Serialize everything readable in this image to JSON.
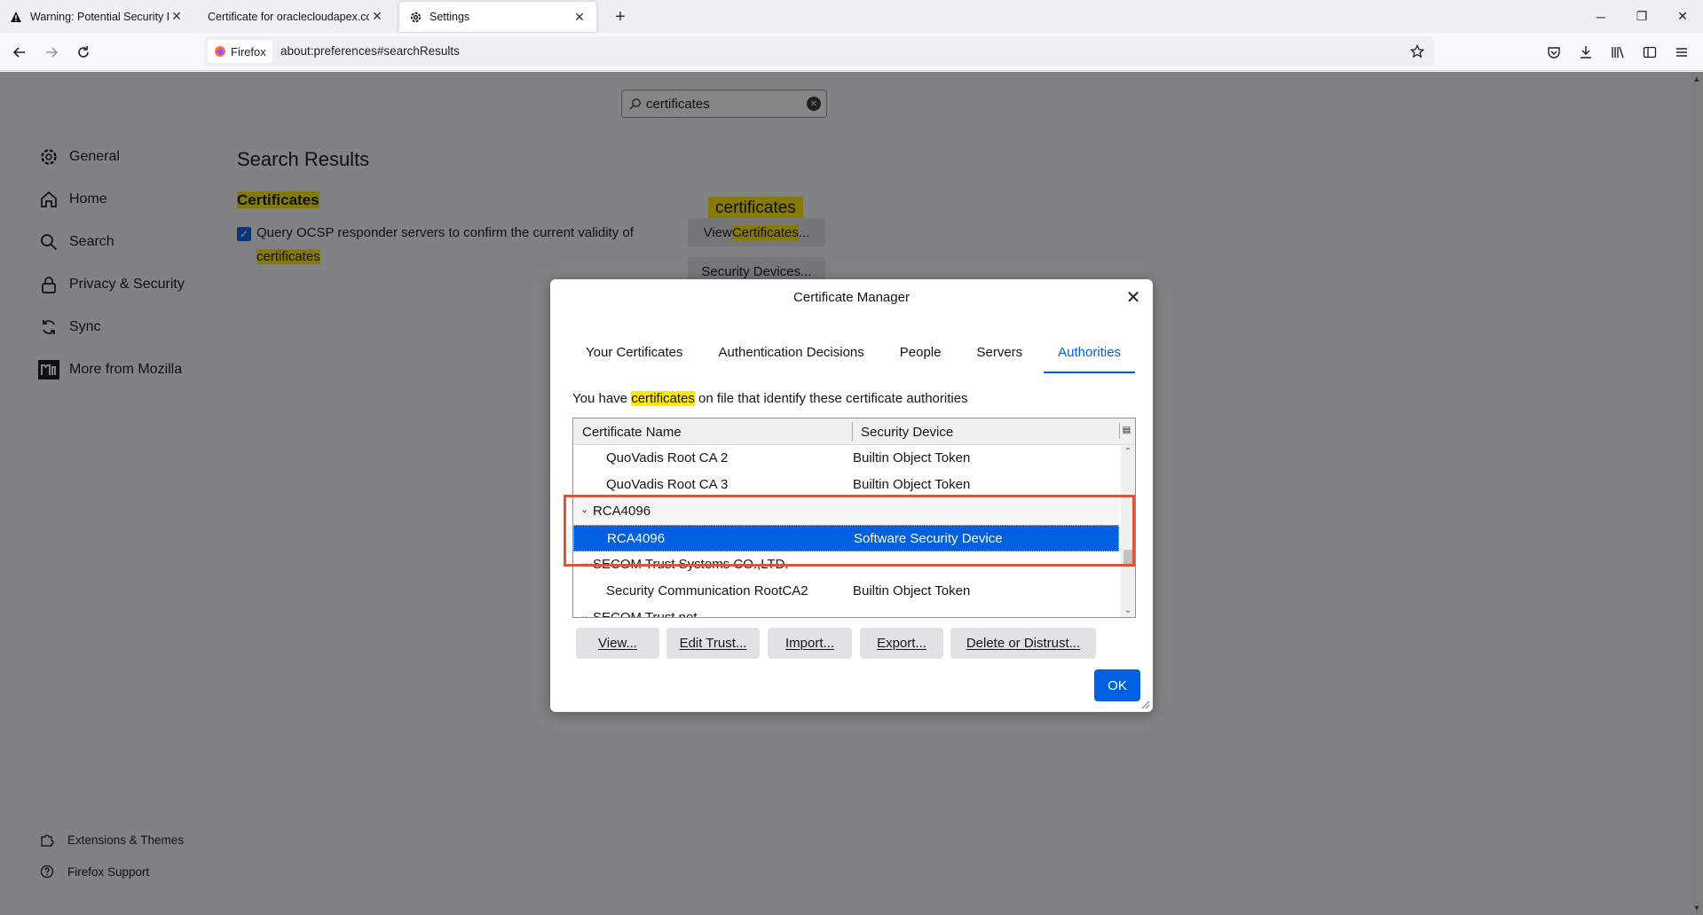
{
  "tabs": [
    {
      "title": "Warning: Potential Security Risk",
      "icon": "warning-icon"
    },
    {
      "title": "Certificate for oraclecloudapex.com",
      "icon": "none"
    },
    {
      "title": "Settings",
      "icon": "gear-icon",
      "active": true
    }
  ],
  "urlbar": {
    "identity_label": "Firefox",
    "url": "about:preferences#searchResults"
  },
  "search": {
    "value": "certificates"
  },
  "sidebar": {
    "items": [
      {
        "label": "General",
        "icon": "gear-icon"
      },
      {
        "label": "Home",
        "icon": "home-icon"
      },
      {
        "label": "Search",
        "icon": "search-icon"
      },
      {
        "label": "Privacy & Security",
        "icon": "lock-icon"
      },
      {
        "label": "Sync",
        "icon": "sync-icon"
      },
      {
        "label": "More from Mozilla",
        "icon": "mozilla-icon"
      }
    ],
    "footer": [
      {
        "label": "Extensions & Themes",
        "icon": "puzzle-icon"
      },
      {
        "label": "Firefox Support",
        "icon": "help-icon"
      }
    ]
  },
  "main": {
    "results_title": "Search Results",
    "section_title": "Certificates",
    "ocsp_text_a": "Query OCSP responder servers to confirm the current validity of",
    "ocsp_text_b": "certificates",
    "ocsp_checked": true,
    "tooltip": "certificates",
    "view_certificates_a": "View ",
    "view_certificates_hl": "Certificates",
    "view_certificates_b": "...",
    "security_devices": "Security Devices..."
  },
  "dialog": {
    "title": "Certificate Manager",
    "tabs": [
      "Your Certificates",
      "Authentication Decisions",
      "People",
      "Servers",
      "Authorities"
    ],
    "selected_tab": "Authorities",
    "desc_a": "You have ",
    "desc_hl": "certificates",
    "desc_b": " on file that identify these certificate authorities",
    "columns": [
      "Certificate Name",
      "Security Device"
    ],
    "rows": [
      {
        "name": "QuoVadis Root CA 2",
        "device": "Builtin Object Token",
        "type": "child"
      },
      {
        "name": "QuoVadis Root CA 3",
        "device": "Builtin Object Token",
        "type": "child"
      },
      {
        "name": "RCA4096",
        "device": "",
        "type": "group"
      },
      {
        "name": "RCA4096",
        "device": "Software Security Device",
        "type": "child",
        "selected": true
      },
      {
        "name": "SECOM Trust Systems CO.,LTD.",
        "device": "",
        "type": "group"
      },
      {
        "name": "Security Communication RootCA2",
        "device": "Builtin Object Token",
        "type": "child"
      },
      {
        "name": "SECOM Trust.net",
        "device": "",
        "type": "group"
      }
    ],
    "buttons": [
      "View...",
      "Edit Trust...",
      "Import...",
      "Export...",
      "Delete or Distrust..."
    ],
    "ok": "OK"
  },
  "colors": {
    "accent": "#0061e0",
    "highlight": "#ffe900",
    "annotation": "#d6573d"
  }
}
